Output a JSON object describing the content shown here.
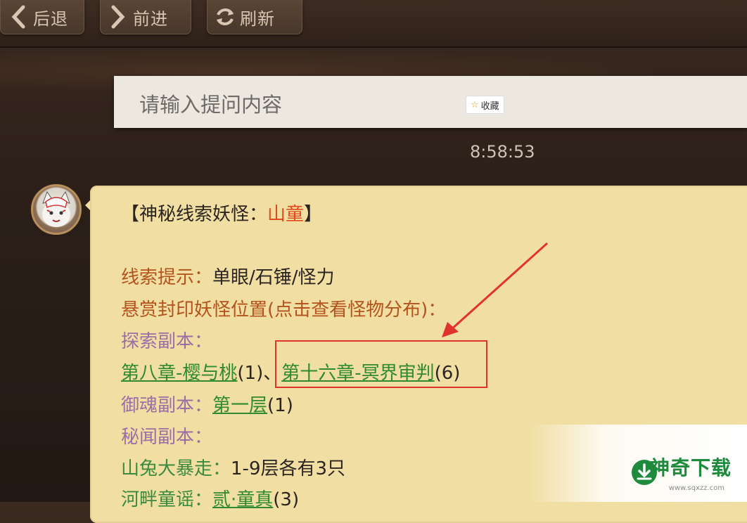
{
  "nav": {
    "back_label": "后退",
    "forward_label": "前进",
    "refresh_label": "刷新"
  },
  "search": {
    "placeholder": "请输入提问内容",
    "fav_label": "收藏"
  },
  "chat": {
    "timestamp": "8:58:53",
    "title_prefix": "【神秘线索妖怪：",
    "title_name": "山童",
    "title_suffix": "】",
    "clue_label": "线索提示：",
    "clue_value": "单眼/石锤/怪力",
    "bounty_label": "悬赏封印妖怪位置(点击查看怪物分布)：",
    "explore_label": "探索副本：",
    "explore_link1": "第八章-樱与桃",
    "explore_count1": "(1)、",
    "explore_link2": "第十六章-冥界审判",
    "explore_count2": "(6)",
    "soul_label": "御魂副本：",
    "soul_link": "第一层",
    "soul_count": "(1)",
    "secret_label": "秘闻副本：",
    "rabbit_label": "山兔大暴走：",
    "rabbit_value": "1-9层各有3只",
    "river_label": "河畔童谣：",
    "river_link": "贰·童真",
    "river_count": "(3)"
  },
  "watermark": {
    "brand": "神奇下载",
    "site": "www.sqxzz.com"
  },
  "colors": {
    "bubble": "#f0dea2",
    "highlight_box": "#e0342a",
    "link_green": "#2f8a2f",
    "brand_green": "#1d8a3c"
  }
}
